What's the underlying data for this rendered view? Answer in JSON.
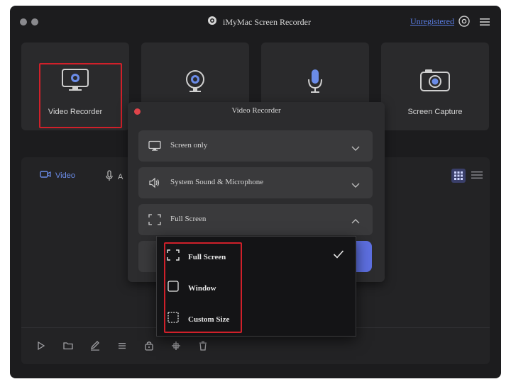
{
  "app": {
    "title": "iMyMac Screen Recorder",
    "unregistered_label": "Unregistered",
    "accent_color": "#5b7fe6",
    "highlight_color": "#d0202a"
  },
  "window_controls": [
    "dot",
    "dot"
  ],
  "cards": [
    {
      "label": "Video Recorder",
      "icon": "monitor-icon",
      "highlighted": true
    },
    {
      "label": "",
      "icon": "webcam-icon",
      "highlighted": false
    },
    {
      "label": "",
      "icon": "microphone-icon",
      "highlighted": false
    },
    {
      "label": "Screen Capture",
      "icon": "camera-icon",
      "highlighted": false
    }
  ],
  "tabs": {
    "video": "Video",
    "audio": "A"
  },
  "dialog": {
    "title": "Video Recorder",
    "rows": [
      {
        "label": "Screen only",
        "icon": "monitor-icon",
        "expanded": false
      },
      {
        "label": "System Sound & Microphone",
        "icon": "speaker-icon",
        "expanded": false
      },
      {
        "label": "Full Screen",
        "icon": "fullscreen-icon",
        "expanded": true
      }
    ]
  },
  "dropdown": {
    "options": [
      {
        "label": "Full Screen",
        "icon": "fullscreen-icon",
        "selected": true
      },
      {
        "label": "Window",
        "icon": "window-icon",
        "selected": false
      },
      {
        "label": "Custom Size",
        "icon": "custom-size-icon",
        "selected": false
      }
    ]
  },
  "toolbar": {
    "icons": [
      "play-icon",
      "folder-icon",
      "edit-icon",
      "list-icon",
      "lock-icon",
      "move-icon",
      "trash-icon"
    ]
  }
}
